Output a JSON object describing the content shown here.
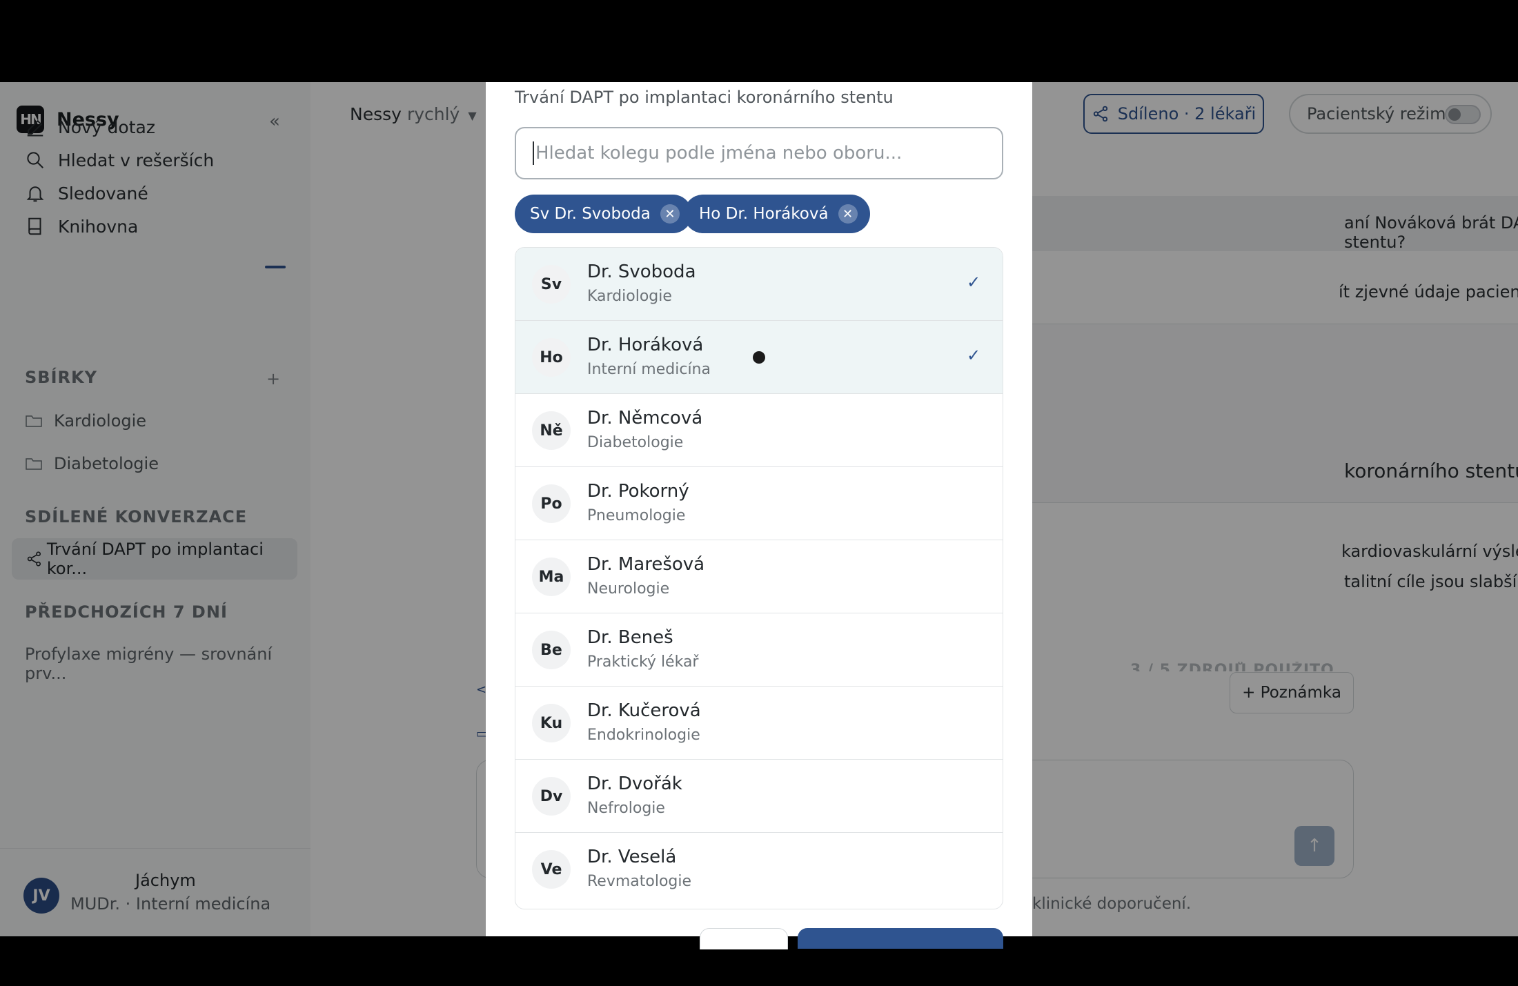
{
  "sidebar": {
    "brand": "Nessy",
    "logo": "HN",
    "collapse": "«",
    "nav": [
      "Nový dotaz",
      "Hledat v rešerších",
      "Sledované",
      "Knihovna"
    ],
    "collections_header": "SBÍRKY",
    "collections": [
      "Kardiologie",
      "Diabetologie"
    ],
    "shared_header": "SDÍLENÉ KONVERZACE",
    "shared_item": "Trvání  DAPT po implantaci kor...",
    "prev_header": "PŘEDCHOZÍCH 7 DNÍ",
    "prev_item": "Profylaxe migrény — srovnání prv...",
    "user": {
      "initials": "JV",
      "name": "Jáchym",
      "role": "MUDr. ·  Interní medicína"
    }
  },
  "main": {
    "model": "Nessy",
    "model_variant": "rychlý",
    "share_label": "Sdíleno · 2 lékaři",
    "patient_mode": "Pacientský režim",
    "user_msg_visible": "aní  Nováková brát  DAPT po stentu?",
    "ai_line1": "ít zjevné údaje pacienta (zkontrolujte):",
    "card_visible": "koronárního stentu",
    "ai_line2": "kardiovaskulární výsledky, nejsilněji",
    "ai_line3": "talitní cíle jsou slabší a méně",
    "sources_faded": "3 / 5 ZDROJŮ POUŽITO",
    "note_button": "+ Poznámka",
    "disclaimer_visible": "klinické doporučení."
  },
  "modal": {
    "title": "Trvání  DAPT po implantaci koronárního stentu",
    "search_placeholder": "Hledat kolegu podle jména nebo oboru...",
    "chips": [
      "Sv  Dr. Svoboda",
      "Ho  Dr. Horáková"
    ],
    "doctors": [
      {
        "initials": "Sv",
        "name": "Dr. Svoboda",
        "specialty": "Kardiologie",
        "selected": true
      },
      {
        "initials": "Ho",
        "name": "Dr. Horáková",
        "specialty": "Interní medicína",
        "selected": true
      },
      {
        "initials": "Ně",
        "name": "Dr. Němcová",
        "specialty": "Diabetologie",
        "selected": false
      },
      {
        "initials": "Po",
        "name": "Dr. Pokorný",
        "specialty": "Pneumologie",
        "selected": false
      },
      {
        "initials": "Ma",
        "name": "Dr. Marešová",
        "specialty": "Neurologie",
        "selected": false
      },
      {
        "initials": "Be",
        "name": "Dr. Beneš",
        "specialty": "Praktický lékař",
        "selected": false
      },
      {
        "initials": "Ku",
        "name": "Dr. Kučerová",
        "specialty": "Endokrinologie",
        "selected": false
      },
      {
        "initials": "Dv",
        "name": "Dr. Dvořák",
        "specialty": "Nefrologie",
        "selected": false
      },
      {
        "initials": "Ve",
        "name": "Dr. Veselá",
        "specialty": "Revmatologie",
        "selected": false
      }
    ],
    "check_mark": "✓",
    "chip_remove": "✕"
  },
  "colors": {
    "accent": "#2f5490",
    "selected_row": "#eef5f6",
    "overlay": "rgba(0,0,0,0.42)"
  }
}
